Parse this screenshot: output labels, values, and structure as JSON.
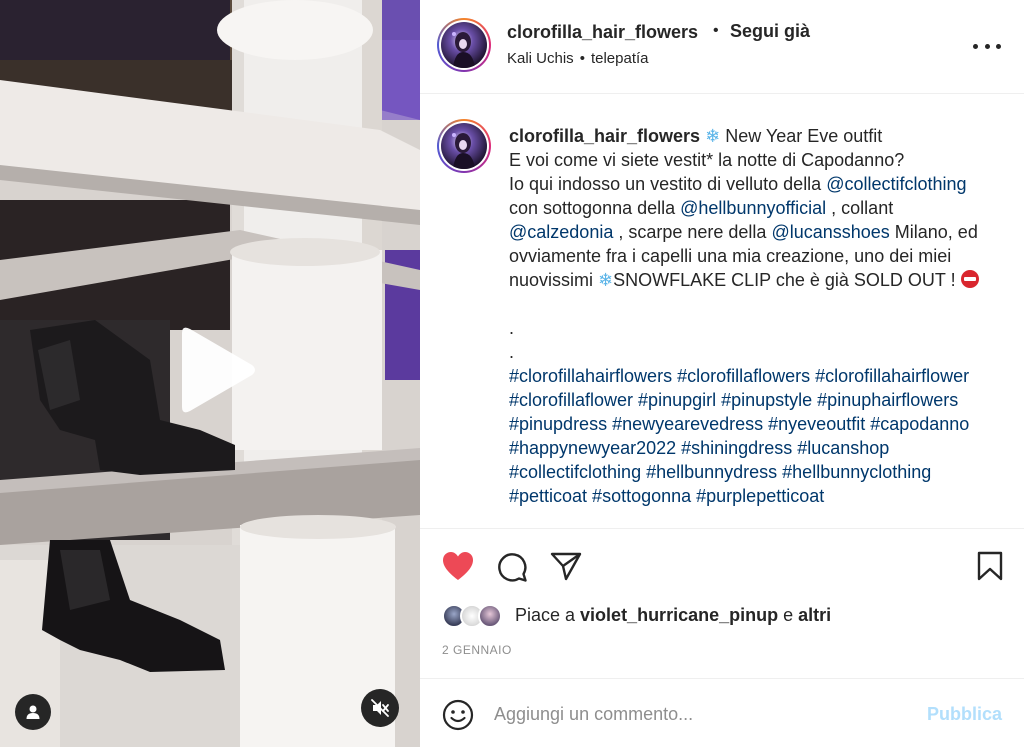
{
  "post": {
    "username": "clorofilla_hair_flowers",
    "dot": "•",
    "follow_label": "Segui già",
    "music_artist": "Kali Uchis",
    "music_sep": "•",
    "music_track": "telepatía"
  },
  "caption": {
    "username": "clorofilla_hair_flowers",
    "p1": " New Year Eve outfit\nE voi come vi siete vestit* la notte di Capodanno?\nIo qui indosso un vestito di velluto della ",
    "m1": "@collectifclothing",
    "p2": "\ncon sottogonna della ",
    "m2": "@hellbunnyofficial",
    "p3": " , collant\n",
    "m3": "@calzedonia",
    "p4": " , scarpe nere della ",
    "m4": "@lucansshoes",
    "p5": " Milano, ed ovviamente fra i capelli una mia creazione, uno dei miei nuovissimi ",
    "p6": "SNOWFLAKE CLIP che è già SOLD OUT ! ",
    "p7": "\n\n.\n.\n",
    "hashtags": "#clorofillahairflowers #clorofillaflowers #clorofillahairflower #clorofillaflower #pinupgirl #pinupstyle #pinuphairflowers #pinupdress #newyearevedress #nyeveoutfit #capodanno #happynewyear2022 #shiningdress #lucanshop #collectifclothing #hellbunnydress #hellbunnyclothing #petticoat #sottogonna #purplepetticoat"
  },
  "likes": {
    "prefix": "Piace a ",
    "user": "violet_hurricane_pinup",
    "conj": " e ",
    "others": "altri"
  },
  "date": "2 GENNAIO",
  "comment": {
    "placeholder": "Aggiungi un commento...",
    "publish_label": "Pubblica"
  },
  "icons": {
    "like": "heart-filled-icon",
    "comment": "speech-bubble-icon",
    "share": "paper-plane-icon",
    "save": "bookmark-icon",
    "more": "ellipsis-icon",
    "emoji": "smiley-icon",
    "play": "play-icon",
    "mute": "speaker-muted-icon",
    "user_tag": "user-icon",
    "snowflake": "snowflake-emoji",
    "no_entry": "no-entry-emoji"
  },
  "colors": {
    "heart": "#ed4956",
    "link": "#00376b",
    "publish_disabled": "#b2dffc",
    "muted_text": "#8e8e8e"
  }
}
